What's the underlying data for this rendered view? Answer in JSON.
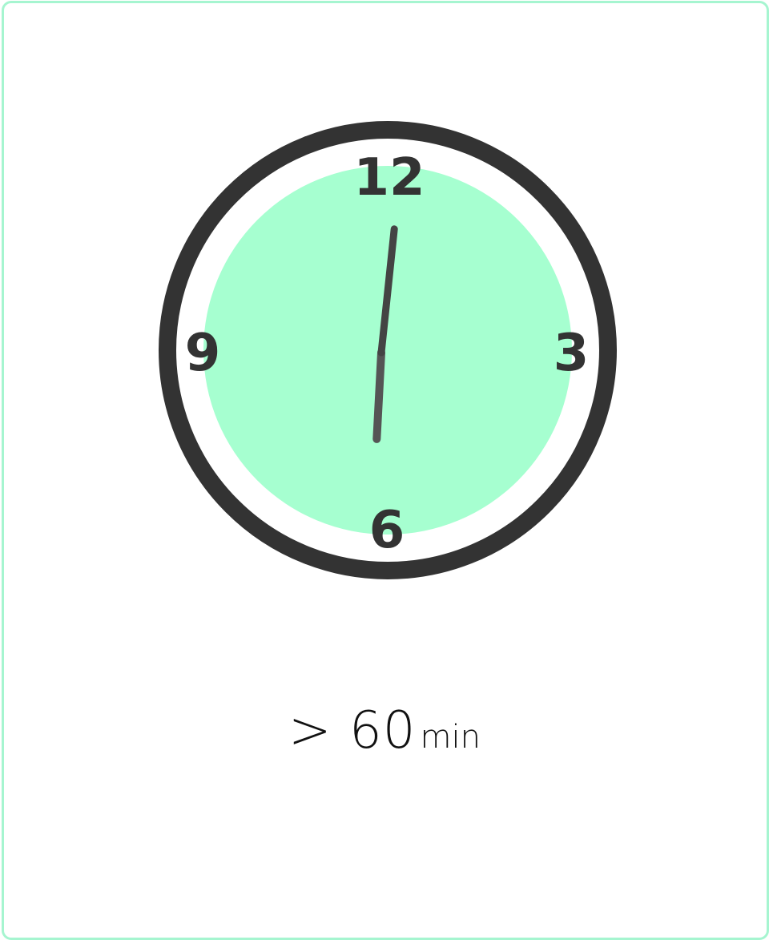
{
  "clock": {
    "numerals": {
      "twelve": "12",
      "three": "3",
      "six": "6",
      "nine": "9"
    },
    "elapsed_fraction": 1.0,
    "hour_hand_angle_deg": 183,
    "minute_hand_angle_deg": 6,
    "colors": {
      "rim": "#333333",
      "fill": "#a6ffd0",
      "hands": "#444444",
      "card_border": "#a6f5d0"
    }
  },
  "duration": {
    "value": "> 60",
    "unit": "min"
  }
}
